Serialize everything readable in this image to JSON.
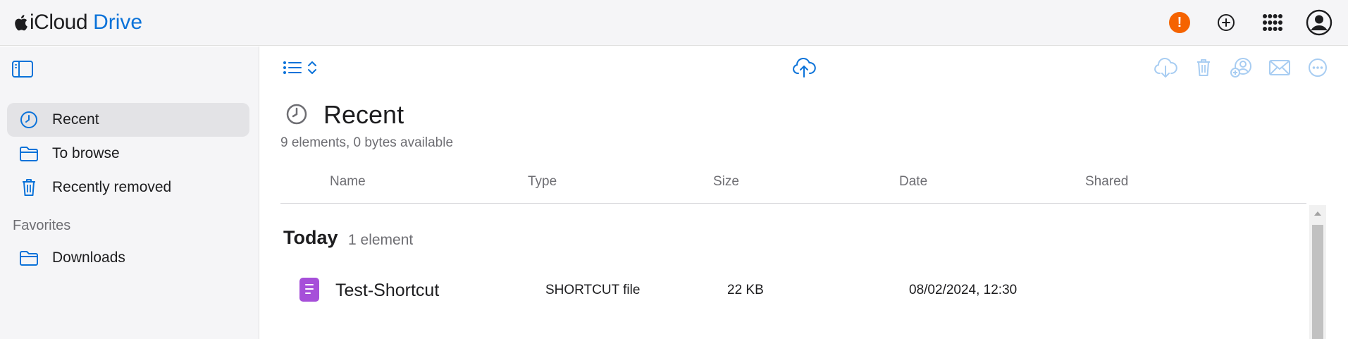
{
  "brand": {
    "icloud": "iCloud",
    "drive": "Drive"
  },
  "topbar": {
    "alert_badge": "!",
    "icons": [
      "alert-icon",
      "add-icon",
      "app-grid-icon",
      "account-icon"
    ]
  },
  "sidebar": {
    "items": [
      {
        "label": "Recent",
        "icon": "clock-icon",
        "active": true
      },
      {
        "label": "To browse",
        "icon": "folder-icon",
        "active": false
      },
      {
        "label": "Recently removed",
        "icon": "trash-icon",
        "active": false
      }
    ],
    "favorites_label": "Favorites",
    "favorites": [
      {
        "label": "Downloads",
        "icon": "folder-icon"
      }
    ]
  },
  "toolbar": {
    "left": [
      "list-view-icon",
      "sort-toggle-icon"
    ],
    "center": [
      "upload-icon"
    ],
    "right": [
      "download-icon",
      "delete-icon",
      "share-icon",
      "mail-icon",
      "more-icon"
    ]
  },
  "main": {
    "title": "Recent",
    "subtitle": "9 elements, 0 bytes available",
    "columns": [
      "Name",
      "Type",
      "Size",
      "Date",
      "Shared"
    ],
    "groups": [
      {
        "title": "Today",
        "count": "1 element",
        "rows": [
          {
            "name": "Test-Shortcut",
            "type": "SHORTCUT file",
            "size": "22 KB",
            "date": "08/02/2024, 12:30",
            "shared": ""
          }
        ]
      }
    ]
  },
  "colors": {
    "accent": "#0a72d9",
    "alert": "#f56300",
    "file_icon": "#a64fd9",
    "sidebar_bg": "#f5f5f7",
    "active_item_bg": "#e3e3e6",
    "disabled_icon": "#a8cdf2"
  }
}
